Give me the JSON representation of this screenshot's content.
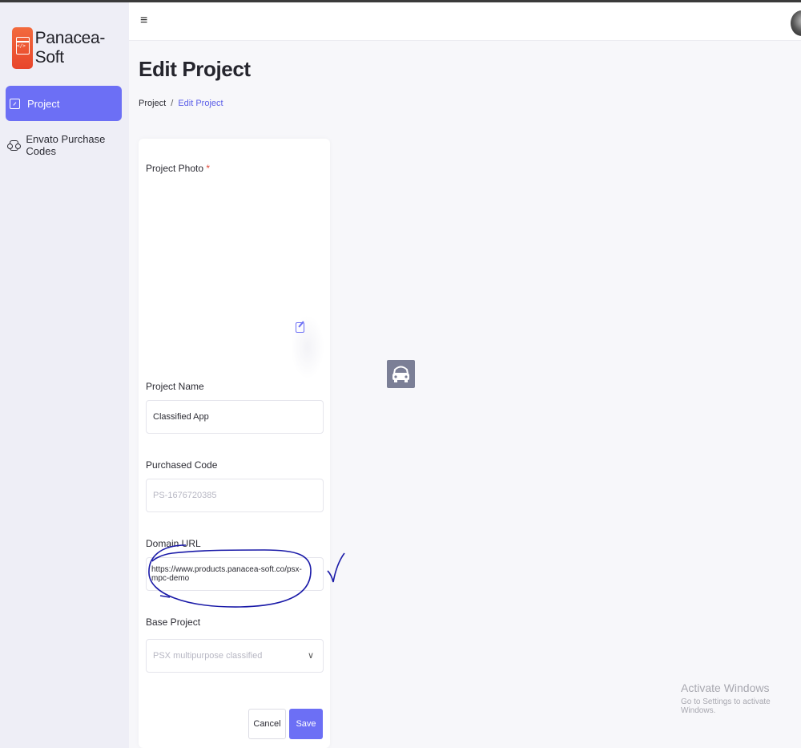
{
  "brand": {
    "name": "Panacea-Soft",
    "logo_code": "</>"
  },
  "sidebar": {
    "items": [
      {
        "label": "Project",
        "icon": "chart-box-icon",
        "active": true
      },
      {
        "label": "Envato Purchase Codes",
        "icon": "ticket-icon",
        "active": false
      }
    ]
  },
  "header": {
    "menu_icon": "≡"
  },
  "page": {
    "title": "Edit Project",
    "breadcrumb": {
      "parent": "Project",
      "separator": "/",
      "current": "Edit Project"
    }
  },
  "form": {
    "photo_label": "Project Photo",
    "required_mark": "*",
    "name_label": "Project Name",
    "name_value": "Classified App",
    "code_label": "Purchased Code",
    "code_placeholder": "PS-1676720385",
    "domain_label": "Domain URL",
    "domain_value": "https://www.products.panacea-soft.co/psx-mpc-demo",
    "base_label": "Base Project",
    "base_placeholder": "PSX multipurpose classified",
    "base_chevron": "∨",
    "cancel_label": "Cancel",
    "save_label": "Save"
  },
  "watermark": {
    "line1": "Activate Windows",
    "line2": "Go to Settings to activate Windows."
  },
  "colors": {
    "accent": "#6c6ff5",
    "brand": "#e8452b",
    "annotation": "#1a1aa8"
  }
}
